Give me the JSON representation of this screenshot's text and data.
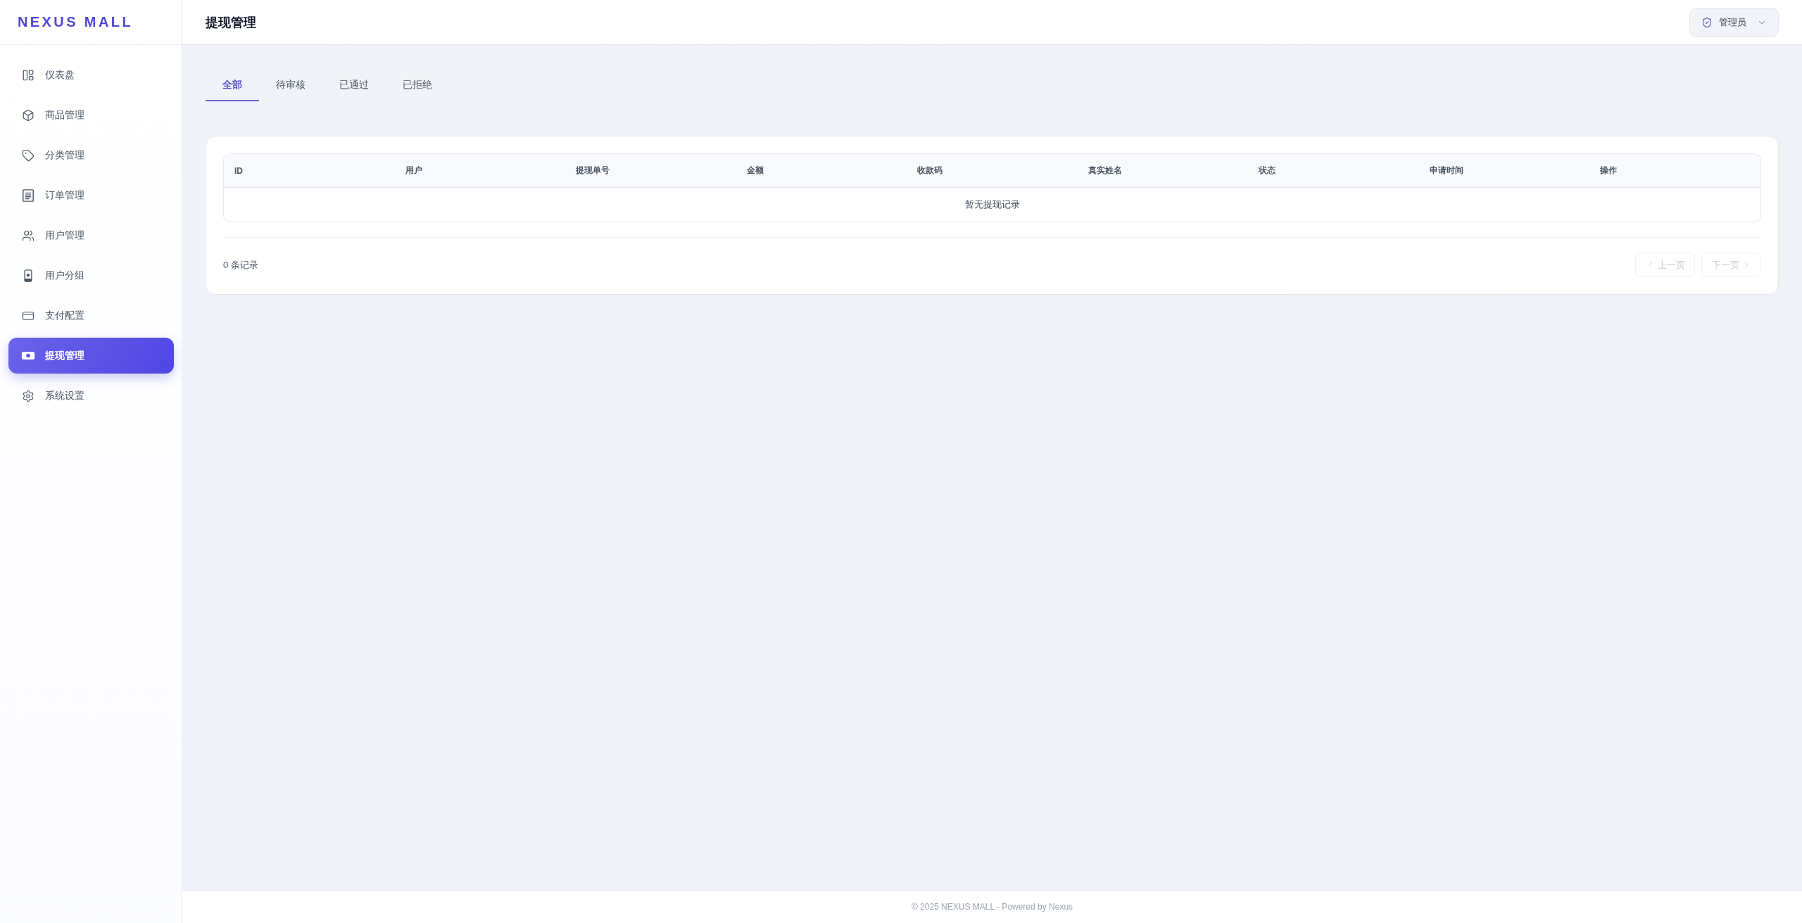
{
  "sidebar": {
    "logo": "NEXUS MALL",
    "items": [
      {
        "label": "仪表盘",
        "selected": false
      },
      {
        "label": "商品管理",
        "selected": false
      },
      {
        "label": "分类管理",
        "selected": false
      },
      {
        "label": "订单管理",
        "selected": false
      },
      {
        "label": "用户管理",
        "selected": false
      },
      {
        "label": "用户分组",
        "selected": false
      },
      {
        "label": "支付配置",
        "selected": false
      },
      {
        "label": "提现管理",
        "selected": true
      },
      {
        "label": "系统设置",
        "selected": false
      }
    ]
  },
  "header": {
    "title": "提现管理",
    "user_menu": "管理员"
  },
  "tabs": [
    {
      "label": "全部",
      "selected": true
    },
    {
      "label": "待审核",
      "selected": false
    },
    {
      "label": "已通过",
      "selected": false
    },
    {
      "label": "已拒绝",
      "selected": false
    }
  ],
  "table": {
    "columns": [
      "ID",
      "用户",
      "提现单号",
      "金额",
      "收款码",
      "真实姓名",
      "状态",
      "申请时间",
      "操作"
    ],
    "empty_message": "暂无提现记录"
  },
  "pagination": {
    "record_count": "0 条记录",
    "previous": {
      "label": "上一页",
      "disabled": true
    },
    "next": {
      "label": "下一页",
      "disabled": true
    }
  },
  "footer": {
    "text": "© 2025 NEXUS MALL - Powered by Nexus"
  }
}
